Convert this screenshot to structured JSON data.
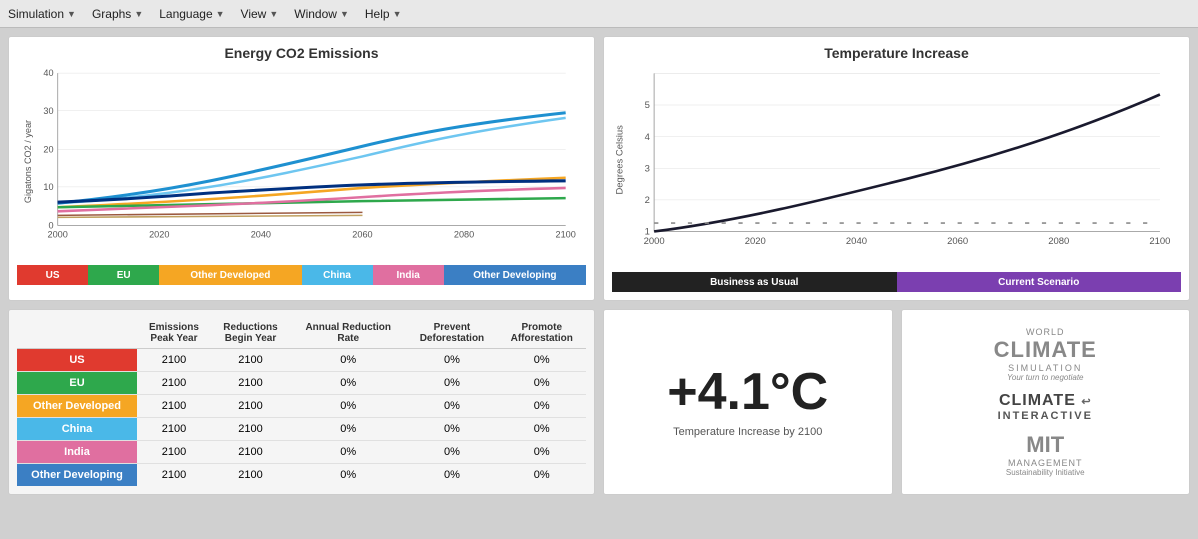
{
  "menubar": {
    "items": [
      {
        "label": "Simulation",
        "id": "simulation"
      },
      {
        "label": "Graphs",
        "id": "graphs"
      },
      {
        "label": "Language",
        "id": "language"
      },
      {
        "label": "View",
        "id": "view"
      },
      {
        "label": "Window",
        "id": "window"
      },
      {
        "label": "Help",
        "id": "help"
      }
    ]
  },
  "energy_chart": {
    "title": "Energy CO2 Emissions",
    "y_axis_label": "Gigatons CO2 / year",
    "y_max": 40,
    "y_values": [
      0,
      10,
      20,
      30,
      40
    ],
    "x_values": [
      2000,
      2020,
      2040,
      2060,
      2080,
      2100
    ]
  },
  "temp_chart": {
    "title": "Temperature Increase",
    "y_axis_label": "Degrees Celsius",
    "y_max": 5,
    "y_values": [
      1,
      2,
      3,
      4,
      5
    ],
    "x_values": [
      2000,
      2020,
      2040,
      2060,
      2080,
      2100
    ]
  },
  "legend_energy": [
    {
      "label": "US",
      "color": "#e03a2f",
      "flex": 1
    },
    {
      "label": "EU",
      "color": "#2ea84c",
      "flex": 1
    },
    {
      "label": "Other Developed",
      "color": "#f5a623",
      "flex": 2
    },
    {
      "label": "China",
      "color": "#4ab8e8",
      "flex": 1
    },
    {
      "label": "India",
      "color": "#e06fa0",
      "flex": 1
    },
    {
      "label": "Other Developing",
      "color": "#3b7fc4",
      "flex": 2
    }
  ],
  "legend_temp": [
    {
      "label": "Business as Usual",
      "color": "#222",
      "flex": 1
    },
    {
      "label": "Current Scenario",
      "color": "#7b3fb0",
      "flex": 1
    }
  ],
  "table": {
    "headers": [
      "",
      "Emissions\nPeak Year",
      "Reductions\nBegin Year",
      "Annual Reduction\nRate",
      "Prevent\nDeforestation",
      "Promote\nAfforestation"
    ],
    "rows": [
      {
        "region": "US",
        "color": "#e03a2f",
        "peak": "2100",
        "begin": "2100",
        "rate": "0%",
        "deforest": "0%",
        "afforest": "0%"
      },
      {
        "region": "EU",
        "color": "#2ea84c",
        "peak": "2100",
        "begin": "2100",
        "rate": "0%",
        "deforest": "0%",
        "afforest": "0%"
      },
      {
        "region": "Other Developed",
        "color": "#f5a623",
        "peak": "2100",
        "begin": "2100",
        "rate": "0%",
        "deforest": "0%",
        "afforest": "0%"
      },
      {
        "region": "China",
        "color": "#4ab8e8",
        "peak": "2100",
        "begin": "2100",
        "rate": "0%",
        "deforest": "0%",
        "afforest": "0%"
      },
      {
        "region": "India",
        "color": "#e06fa0",
        "peak": "2100",
        "begin": "2100",
        "rate": "0%",
        "deforest": "0%",
        "afforest": "0%"
      },
      {
        "region": "Other Developing",
        "color": "#3b7fc4",
        "peak": "2100",
        "begin": "2100",
        "rate": "0%",
        "deforest": "0%",
        "afforest": "0%"
      }
    ]
  },
  "temperature": {
    "value": "+4.1°C",
    "label": "Temperature Increase by 2100"
  },
  "logos": {
    "world": "WORLD",
    "climate_big": "CLIMATE",
    "simulation": "SIMULATION",
    "your_turn": "Your turn to negotiate",
    "climate_interactive": "CLIMATE",
    "interactive": "INTERACTIVE",
    "mit": "MIT",
    "management": "MANAGEMENT",
    "sustainability": "Sustainability Initiative"
  }
}
